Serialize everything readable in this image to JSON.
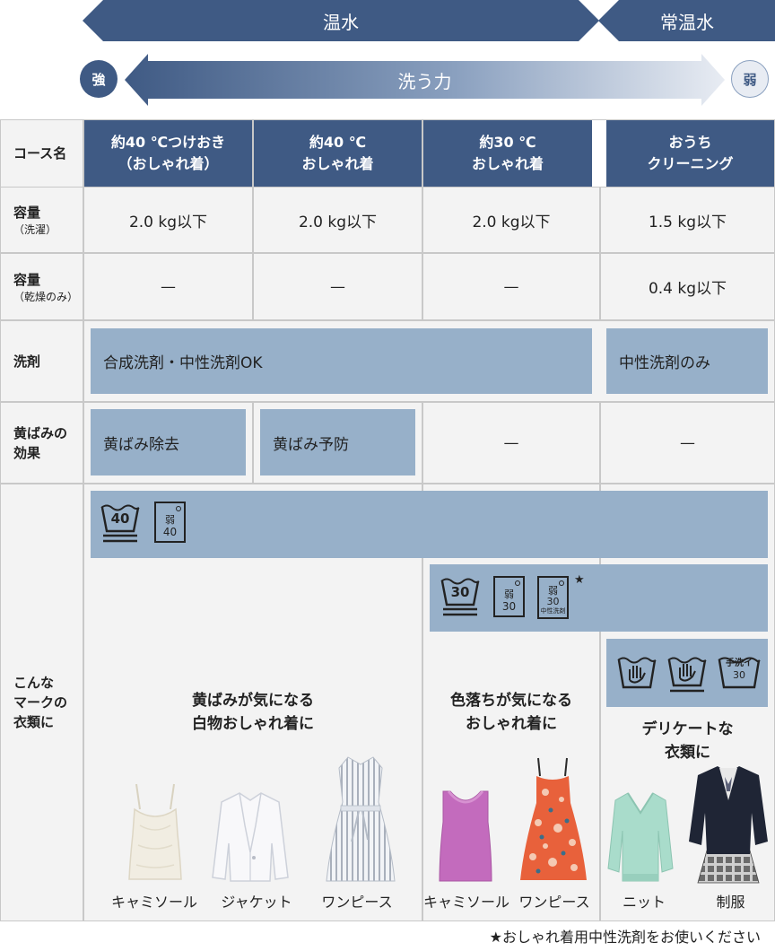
{
  "temperature": {
    "warm": "温水",
    "normal": "常温水"
  },
  "power": {
    "label": "洗う力",
    "strong": "強",
    "weak": "弱"
  },
  "colors": {
    "navy": "#3f5a84",
    "band": "#97b0c9",
    "cell": "#f3f3f3",
    "border": "#c8c8c8"
  },
  "row_labels": {
    "course": "コース名",
    "capacity_wash": {
      "main": "容量",
      "sub": "（洗濯）"
    },
    "capacity_dry": {
      "main": "容量",
      "sub": "（乾燥のみ）"
    },
    "detergent": "洗剤",
    "yellowing": {
      "line1": "黄ばみの",
      "line2": "効果"
    },
    "marks": {
      "line1": "こんな",
      "line2": "マークの",
      "line3": "衣類に"
    }
  },
  "courses": [
    {
      "line1": "約40 ℃つけおき",
      "line2": "（おしゃれ着）",
      "capacity_wash": "2.0 kg以下",
      "capacity_dry": "—"
    },
    {
      "line1": "約40 ℃",
      "line2": "おしゃれ着",
      "capacity_wash": "2.0 kg以下",
      "capacity_dry": "—"
    },
    {
      "line1": "約30 ℃",
      "line2": "おしゃれ着",
      "capacity_wash": "2.0 kg以下",
      "capacity_dry": "—"
    },
    {
      "line1": "おうち",
      "line2": "クリーニング",
      "capacity_wash": "1.5 kg以下",
      "capacity_dry": "0.4 kg以下"
    }
  ],
  "detergent": {
    "shared": "合成洗剤・中性洗剤OK",
    "home": "中性洗剤のみ"
  },
  "yellowing": {
    "remove": "黄ばみ除去",
    "prevent": "黄ばみ予防",
    "c3": "—",
    "c4": "—"
  },
  "care_icons": {
    "tub40": "40",
    "weak": "弱",
    "weak40": "40",
    "tub30": "30",
    "weak30": "30",
    "neutral": "中性洗剤",
    "star": "★",
    "handwash": "手洗イ",
    "handwash30": "30"
  },
  "categories": {
    "white": {
      "line1": "黄ばみが気になる",
      "line2": "白物おしゃれ着に"
    },
    "color": {
      "line1": "色落ちが気になる",
      "line2": "おしゃれ着に"
    },
    "delicate": {
      "line1": "デリケートな",
      "line2": "衣類に"
    }
  },
  "clothes": [
    "キャミソール",
    "ジャケット",
    "ワンピース",
    "キャミソール",
    "ワンピース",
    "ニット",
    "制服"
  ],
  "footnote": "★おしゃれ着用中性洗剤をお使いください"
}
